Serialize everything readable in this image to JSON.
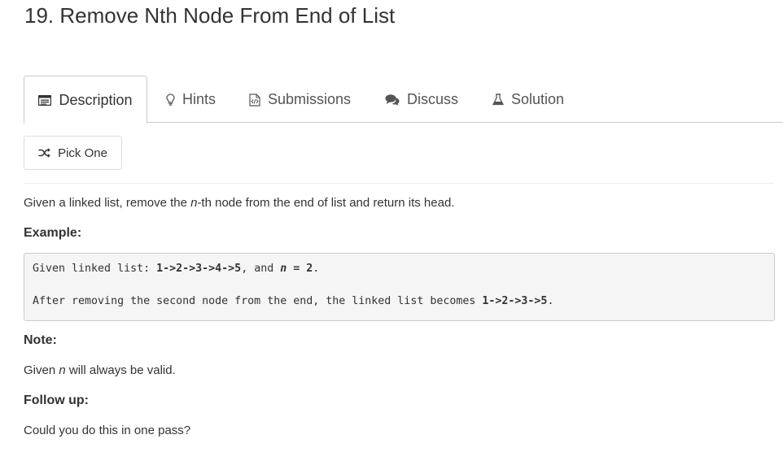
{
  "problem": {
    "title": "19. Remove Nth Node From End of List"
  },
  "tabs": [
    {
      "label": "Description",
      "icon": "description-icon",
      "active": true
    },
    {
      "label": "Hints",
      "icon": "lightbulb-icon",
      "active": false
    },
    {
      "label": "Submissions",
      "icon": "code-file-icon",
      "active": false
    },
    {
      "label": "Discuss",
      "icon": "chat-bubble-icon",
      "active": false
    },
    {
      "label": "Solution",
      "icon": "flask-icon",
      "active": false
    }
  ],
  "pick_one": {
    "label": "Pick One",
    "icon": "shuffle-icon"
  },
  "description": {
    "intro_before": "Given a linked list, remove the ",
    "intro_n": "n",
    "intro_after": "-th node from the end of list and return its head.",
    "example_heading": "Example:",
    "example_line1": {
      "prefix": "Given linked list: ",
      "list": "1->2->3->4->5",
      "mid": ", and ",
      "n_var": "n",
      "equals": " = 2",
      "end": "."
    },
    "example_line2": {
      "prefix": "After removing the second node from the end, the linked list becomes ",
      "list": "1->2->3->5",
      "end": "."
    },
    "note_heading": "Note:",
    "note_before": "Given ",
    "note_n": "n",
    "note_after": " will always be valid.",
    "followup_heading": "Follow up:",
    "followup_text": "Could you do this in one pass?"
  },
  "colors": {
    "text": "#333333",
    "muted": "#555555",
    "border": "#cccccc",
    "code_bg": "#f5f5f5"
  }
}
